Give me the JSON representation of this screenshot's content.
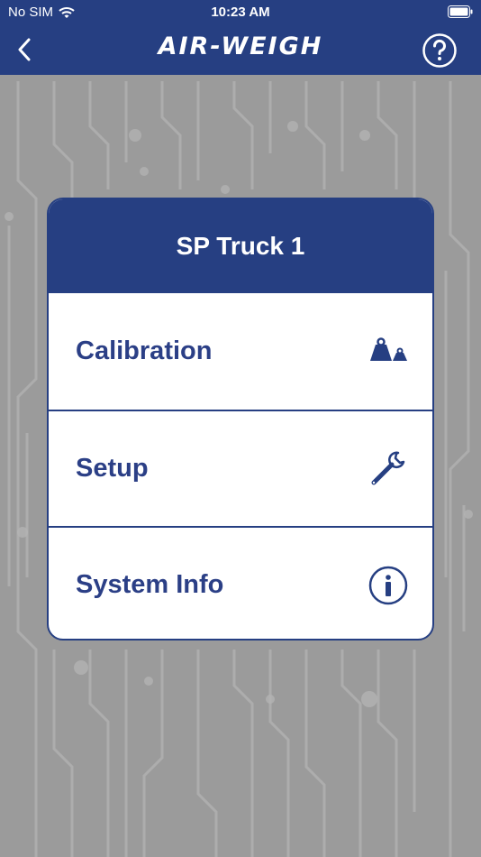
{
  "status_bar": {
    "carrier": "No SIM",
    "time": "10:23 AM",
    "wifi_icon": "wifi-icon",
    "battery_icon": "battery-icon"
  },
  "nav": {
    "brand": "AIR-WEIGH",
    "back_icon": "chevron-left-icon",
    "help_icon": "question-circle-icon"
  },
  "card": {
    "title": "SP Truck 1",
    "items": [
      {
        "label": "Calibration",
        "icon": "weights-icon"
      },
      {
        "label": "Setup",
        "icon": "wrench-icon"
      },
      {
        "label": "System Info",
        "icon": "info-circle-icon"
      }
    ]
  },
  "colors": {
    "primary": "#263f82",
    "text": "#2b3f86",
    "background": "#9a9a9a"
  }
}
